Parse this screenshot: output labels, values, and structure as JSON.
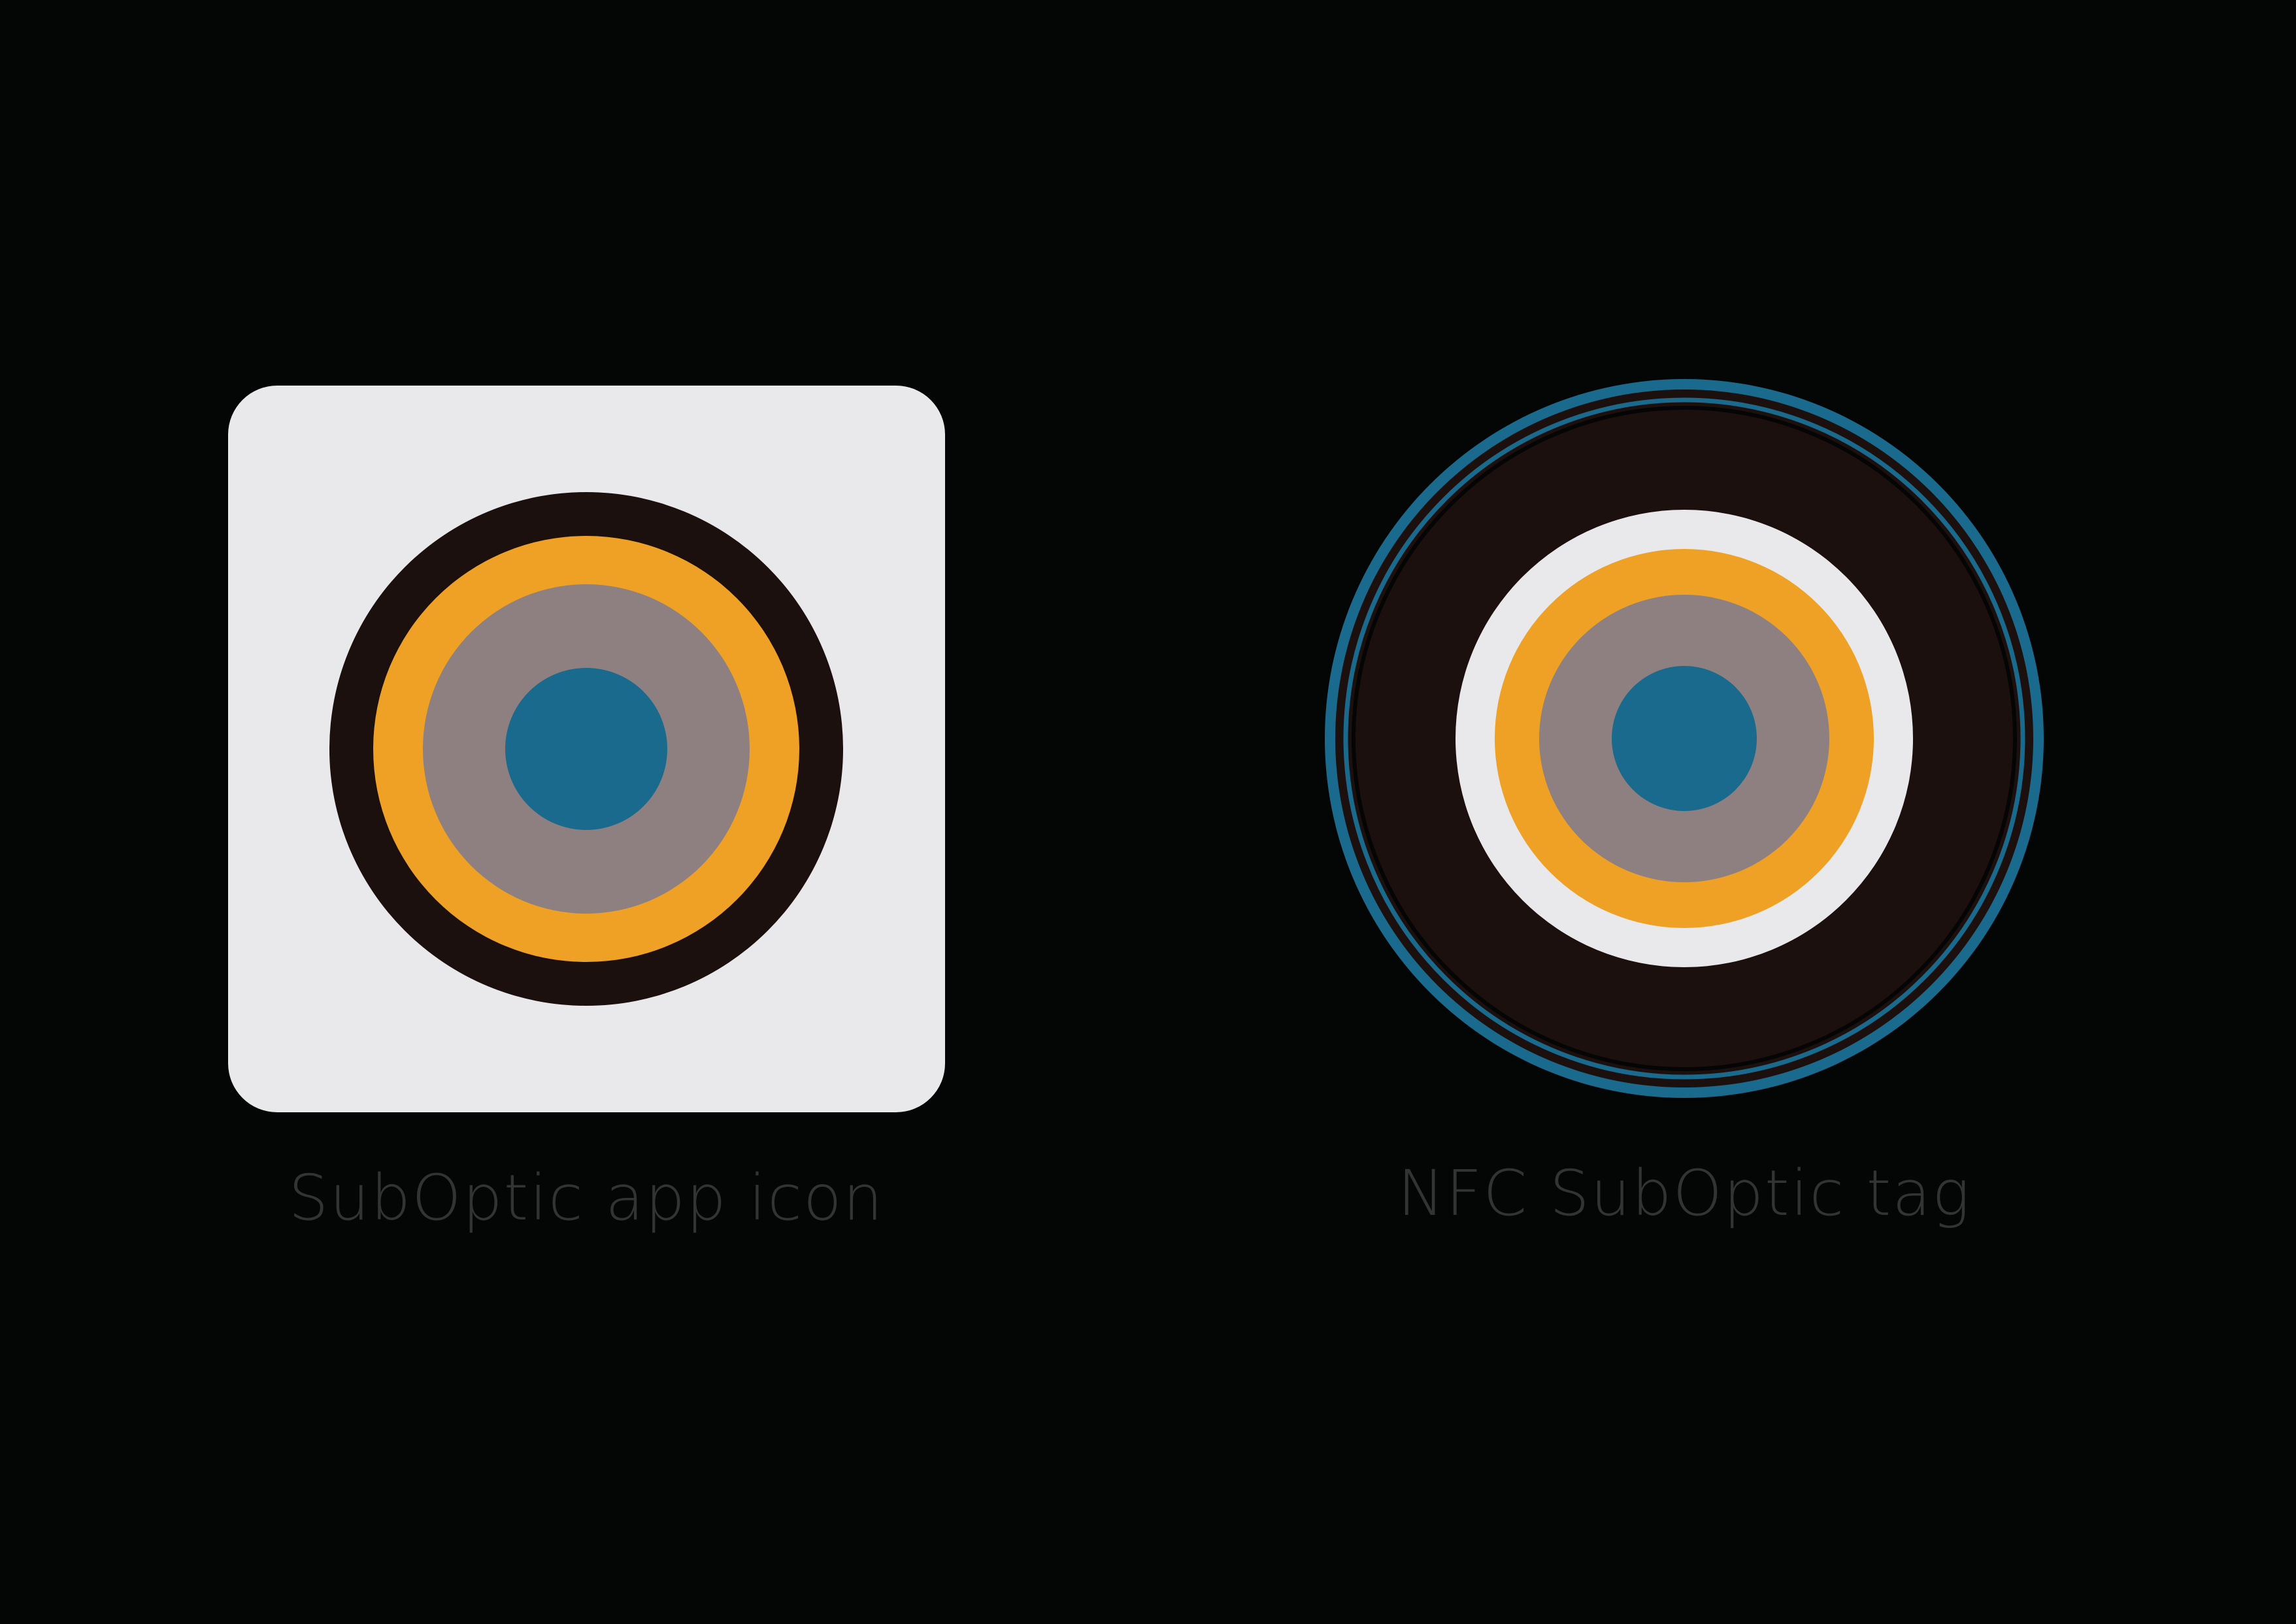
{
  "captions": {
    "app_icon": "SubOptic app icon",
    "nfc_tag": "NFC SubOptic tag"
  },
  "colors": {
    "background": "#040606",
    "light_gray": "#E9E9EB",
    "dark_brown": "#1B100E",
    "orange": "#EEA125",
    "mauve_gray": "#8E8081",
    "teal_blue": "#196A8C",
    "caption_gray": "#333333"
  }
}
